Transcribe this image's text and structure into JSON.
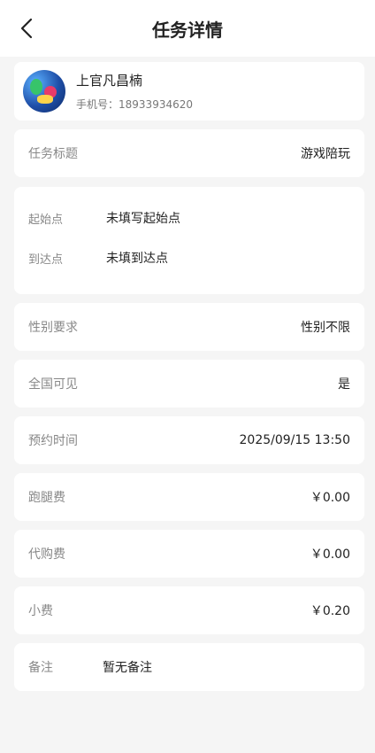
{
  "header": {
    "title": "任务详情"
  },
  "user": {
    "name": "上官凡昌楠",
    "phone_label": "手机号：",
    "phone": "18933934620"
  },
  "task": {
    "title_label": "任务标题",
    "title_value": "游戏陪玩",
    "start_label": "起始点",
    "start_value": "未填写起始点",
    "end_label": "到达点",
    "end_value": "未填到达点",
    "gender_label": "性别要求",
    "gender_value": "性别不限",
    "nationwide_label": "全国可见",
    "nationwide_value": "是",
    "time_label": "预约时间",
    "time_value": "2025/09/15 13:50",
    "run_fee_label": "跑腿费",
    "run_fee_value": "￥0.00",
    "purchase_fee_label": "代购费",
    "purchase_fee_value": "￥0.00",
    "tip_label": "小费",
    "tip_value": "￥0.20",
    "remark_label": "备注",
    "remark_value": "暂无备注"
  },
  "icons": {
    "back": "chevron-left-icon"
  }
}
